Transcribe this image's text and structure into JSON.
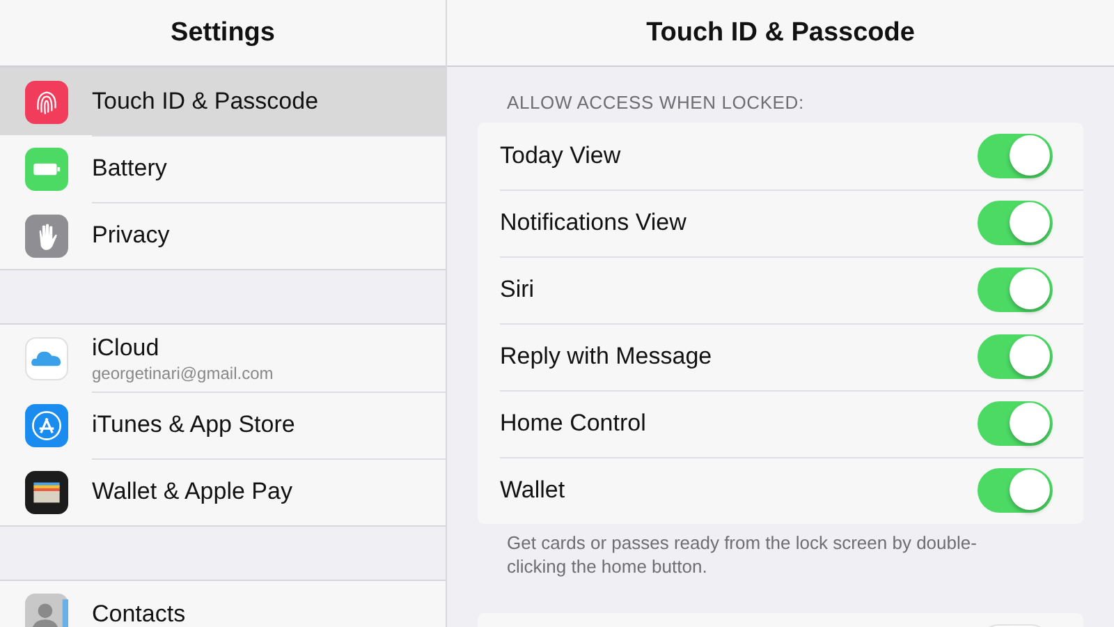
{
  "sidebar": {
    "title": "Settings",
    "groups": [
      {
        "items": [
          {
            "label": "Touch ID & Passcode",
            "kind": "fingerprint",
            "selected": true
          },
          {
            "label": "Battery",
            "kind": "battery",
            "selected": false
          },
          {
            "label": "Privacy",
            "kind": "hand",
            "selected": false
          }
        ]
      },
      {
        "items": [
          {
            "label": "iCloud",
            "subtitle": "georgetinari@gmail.com",
            "kind": "cloud",
            "selected": false
          },
          {
            "label": "iTunes & App Store",
            "kind": "appstore",
            "selected": false
          },
          {
            "label": "Wallet & Apple Pay",
            "kind": "wallet",
            "selected": false
          }
        ]
      },
      {
        "items": [
          {
            "label": "Contacts",
            "kind": "contacts",
            "selected": false
          }
        ]
      }
    ]
  },
  "detail": {
    "title": "Touch ID & Passcode",
    "section_header": "ALLOW ACCESS WHEN LOCKED:",
    "rows": [
      {
        "label": "Today View",
        "on": true
      },
      {
        "label": "Notifications View",
        "on": true
      },
      {
        "label": "Siri",
        "on": true
      },
      {
        "label": "Reply with Message",
        "on": true
      },
      {
        "label": "Home Control",
        "on": true
      },
      {
        "label": "Wallet",
        "on": true
      }
    ],
    "footer": "Get cards or passes ready from the lock screen by double-clicking the home button.",
    "next_group_rows": [
      {
        "on": false
      }
    ]
  }
}
